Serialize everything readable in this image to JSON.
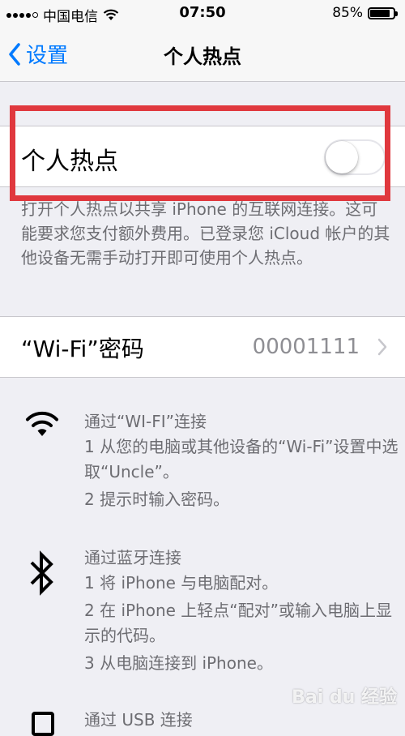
{
  "status_bar": {
    "carrier": "中国电信",
    "time": "07:50",
    "battery_percent": "85%",
    "battery_level": 0.85
  },
  "nav": {
    "back_label": "设置",
    "title": "个人热点"
  },
  "hotspot": {
    "label": "个人热点",
    "enabled": false,
    "footer": "打开个人热点以共享 iPhone 的互联网连接。这可能要求您支付额外费用。已登录您 iCloud 帐户的其他设备无需手动打开即可使用个人热点。"
  },
  "wifi_password": {
    "label": "“Wi-Fi”密码",
    "value": "00001111"
  },
  "instructions": {
    "wifi": {
      "title": "通过“WI-FI”连接",
      "steps": [
        "1 从您的电脑或其他设备的“Wi-Fi”设置中选取“Uncle”。",
        "2 提示时输入密码。"
      ]
    },
    "bluetooth": {
      "title": "通过蓝牙连接",
      "steps": [
        "1 将 iPhone 与电脑配对。",
        "2 在 iPhone 上轻点“配对”或输入电脑上显示的代码。",
        "3 从电脑连接到 iPhone。"
      ]
    },
    "usb": {
      "title": "通过 USB 连接"
    }
  },
  "colors": {
    "accent": "#007aff",
    "highlight": "#e0383e",
    "secondary_text": "#6d6d72"
  },
  "watermark": "Bai du 经验"
}
